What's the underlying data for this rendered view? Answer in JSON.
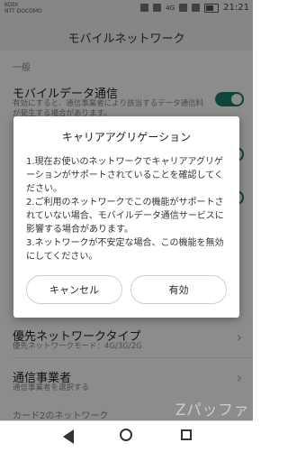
{
  "status_bar": {
    "carrier_1": "KDDI",
    "carrier_2": "NTT DOCOMO",
    "network": "4G",
    "time": "21:21"
  },
  "header": {
    "title": "モバイルネットワーク"
  },
  "sections": {
    "general": "一般",
    "card2": "カード2のネットワーク"
  },
  "rows": {
    "mobile_data": {
      "title": "モバイルデータ通信",
      "subtitle": "有効にすると、通信事業者により該当するデータ通信料が発生する場合があります。",
      "enabled": true
    },
    "preferred_network": {
      "title": "優先ネットワークタイプ",
      "subtitle": "優先ネットワークモード：4G/3G/2G"
    },
    "carrier": {
      "title": "通信事業者",
      "subtitle": "通信事業者を選択する"
    }
  },
  "dialog": {
    "title": "キャリアアグリゲーション",
    "paragraphs": [
      "1.現在お使いのネットワークでキャリアアグリゲーションがサポートされていることを確認してください。",
      "2.ご利用のネットワークでこの機能がサポートされていない場合、モバイルデータ通信サービスに影響する場合があります。",
      "3.ネットワークが不安定な場合、この機能を無効にしてください。"
    ],
    "cancel_label": "キャンセル",
    "ok_label": "有効"
  },
  "watermark": "Zパッファ",
  "colors": {
    "accent": "#1c7c69"
  }
}
